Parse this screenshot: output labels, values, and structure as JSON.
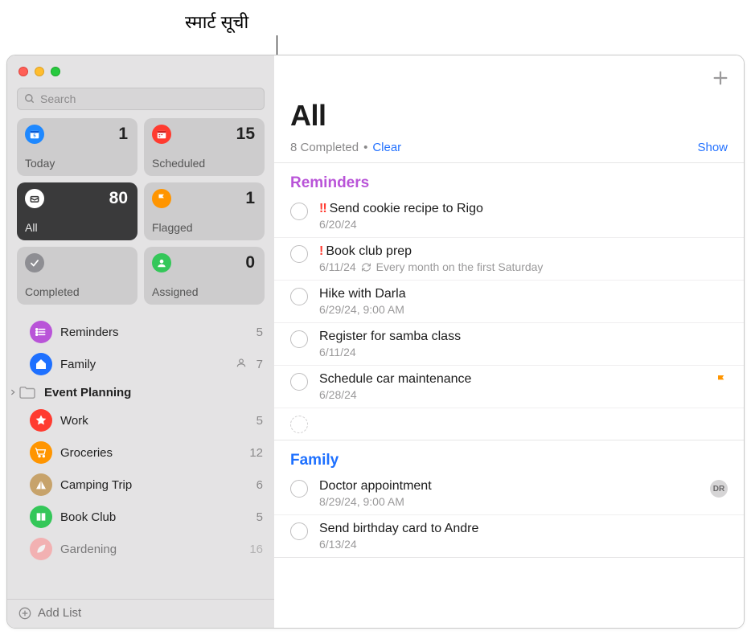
{
  "annotation": {
    "label": "स्मार्ट सूची"
  },
  "search": {
    "placeholder": "Search"
  },
  "smart": [
    {
      "key": "today",
      "label": "Today",
      "count": "1",
      "color": "ic-blue",
      "active": false
    },
    {
      "key": "scheduled",
      "label": "Scheduled",
      "count": "15",
      "color": "ic-red",
      "active": false
    },
    {
      "key": "all",
      "label": "All",
      "count": "80",
      "color": "ic-white",
      "active": true
    },
    {
      "key": "flagged",
      "label": "Flagged",
      "count": "1",
      "color": "ic-orange",
      "active": false
    },
    {
      "key": "completed",
      "label": "Completed",
      "count": "",
      "color": "ic-gray",
      "active": false
    },
    {
      "key": "assigned",
      "label": "Assigned",
      "count": "0",
      "color": "ic-green",
      "active": false
    }
  ],
  "lists": [
    {
      "name": "Reminders",
      "count": "5",
      "shared": false,
      "header": false,
      "color": "#b954d8",
      "icon": "list"
    },
    {
      "name": "Family",
      "count": "7",
      "shared": true,
      "header": false,
      "color": "#1e70ff",
      "icon": "home"
    },
    {
      "name": "Event Planning",
      "count": "",
      "shared": false,
      "header": true,
      "color": "#a5a4a5",
      "icon": "folder"
    },
    {
      "name": "Work",
      "count": "5",
      "shared": false,
      "header": false,
      "color": "#ff3b30",
      "icon": "star"
    },
    {
      "name": "Groceries",
      "count": "12",
      "shared": false,
      "header": false,
      "color": "#ff9500",
      "icon": "cart"
    },
    {
      "name": "Camping Trip",
      "count": "6",
      "shared": false,
      "header": false,
      "color": "#c7a36b",
      "icon": "tent"
    },
    {
      "name": "Book Club",
      "count": "5",
      "shared": false,
      "header": false,
      "color": "#34c759",
      "icon": "book"
    },
    {
      "name": "Gardening",
      "count": "16",
      "shared": false,
      "header": false,
      "color": "#ff8a8a",
      "icon": "leaf",
      "partial": true
    }
  ],
  "footer": {
    "add_list": "Add List"
  },
  "main": {
    "title": "All",
    "completed_text": "8 Completed",
    "dot": "•",
    "clear": "Clear",
    "show": "Show"
  },
  "sections": [
    {
      "title": "Reminders",
      "class": "sec-reminders",
      "items": [
        {
          "priority": "!!",
          "title": "Send cookie recipe to Rigo",
          "meta": "6/20/24",
          "repeat": false,
          "flag": false,
          "avatar": ""
        },
        {
          "priority": "!",
          "title": "Book club prep",
          "meta": "6/11/24",
          "repeat": true,
          "repeat_text": "Every month on the first Saturday",
          "flag": false,
          "avatar": ""
        },
        {
          "priority": "",
          "title": "Hike with Darla",
          "meta": "6/29/24, 9:00 AM",
          "repeat": false,
          "flag": false,
          "avatar": ""
        },
        {
          "priority": "",
          "title": "Register for samba class",
          "meta": "6/11/24",
          "repeat": false,
          "flag": false,
          "avatar": ""
        },
        {
          "priority": "",
          "title": "Schedule car maintenance",
          "meta": "6/28/24",
          "repeat": false,
          "flag": true,
          "avatar": ""
        }
      ],
      "has_placeholder_row": true
    },
    {
      "title": "Family",
      "class": "sec-family",
      "items": [
        {
          "priority": "",
          "title": "Doctor appointment",
          "meta": "8/29/24, 9:00 AM",
          "repeat": false,
          "flag": false,
          "avatar": "DR"
        },
        {
          "priority": "",
          "title": "Send birthday card to Andre",
          "meta": "6/13/24",
          "repeat": false,
          "flag": false,
          "avatar": ""
        }
      ],
      "has_placeholder_row": false
    }
  ]
}
